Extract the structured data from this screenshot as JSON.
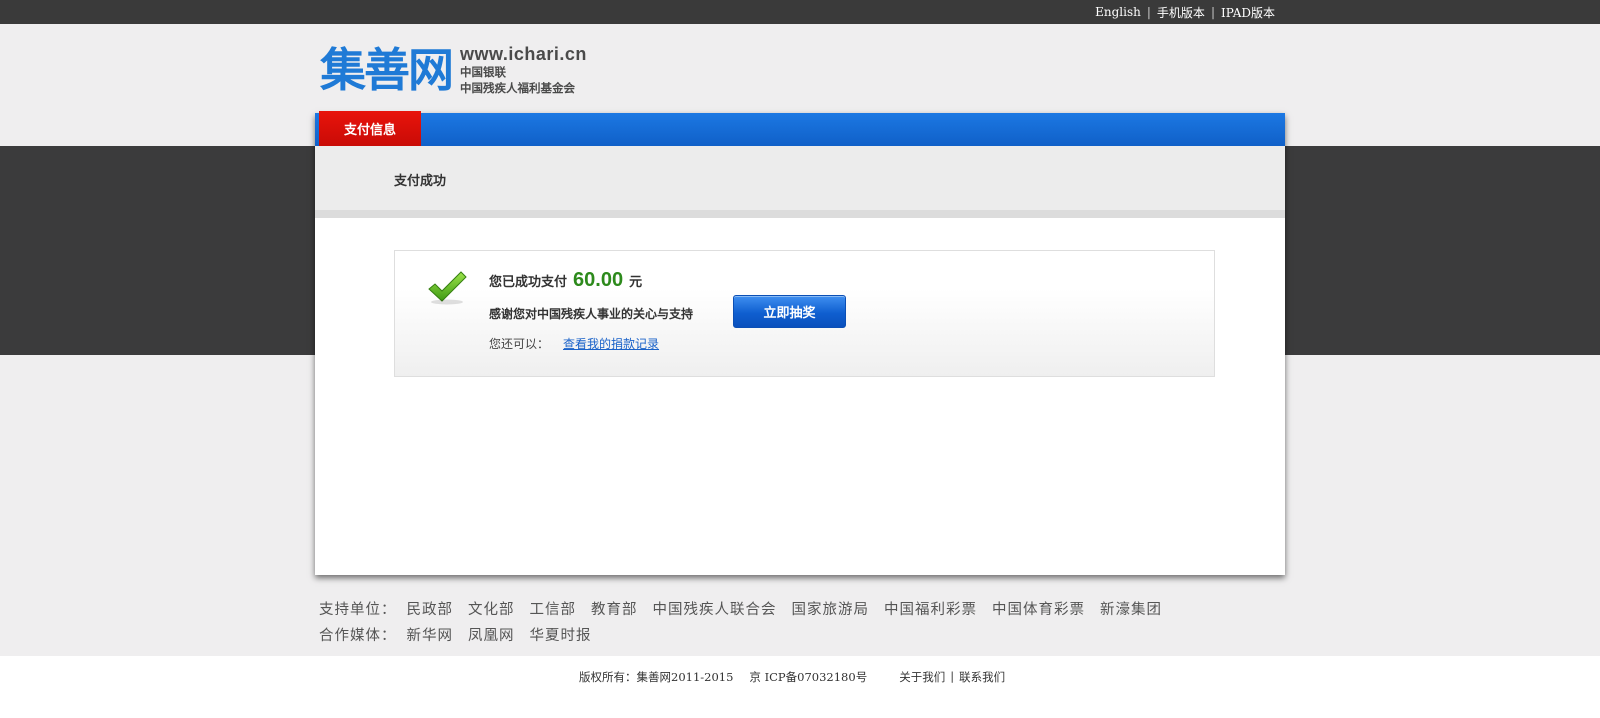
{
  "topbar": {
    "links": [
      "English",
      "手机版本",
      "IPAD版本"
    ]
  },
  "logo": {
    "mark": "集善网",
    "url": "www.ichari.cn",
    "sub1": "中国银联",
    "sub2": "中国残疾人福利基金会"
  },
  "card": {
    "tab": "支付信息",
    "subtitle": "支付成功",
    "success": {
      "prefix": "您已成功支付",
      "amount": "60.00",
      "unit": "元",
      "thanks": "感谢您对中国残疾人事业的关心与支持",
      "button": "立即抽奖",
      "also_label": "您还可以：",
      "record_link": "查看我的捐款记录"
    }
  },
  "support": {
    "label": "支持单位：",
    "items": [
      "民政部",
      "文化部",
      "工信部",
      "教育部",
      "中国残疾人联合会",
      "国家旅游局",
      "中国福利彩票",
      "中国体育彩票",
      "新濠集团"
    ],
    "media_label": "合作媒体：",
    "media": [
      "新华网",
      "凤凰网",
      "华夏时报"
    ]
  },
  "footer": {
    "copyright": "版权所有：集善网2011-2015",
    "icp": "京 ICP备07032180号",
    "about": "关于我们",
    "contact": "联系我们"
  },
  "colors": {
    "accent_blue": "#1c78e3",
    "tab_red": "#e8140c",
    "amount_green": "#2d8a1c",
    "dark_band": "#3b3b3c"
  }
}
